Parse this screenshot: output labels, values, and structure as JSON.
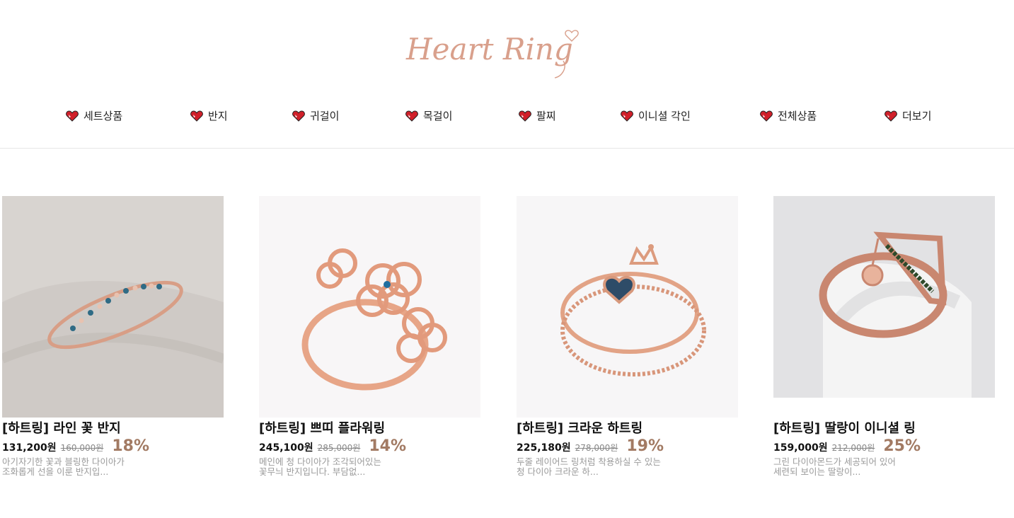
{
  "logo": {
    "text": "Heart Ring",
    "color": "#d9a08c"
  },
  "nav": {
    "icon": "heart-icon",
    "items": [
      {
        "label": "세트상품"
      },
      {
        "label": "반지"
      },
      {
        "label": "귀걸이"
      },
      {
        "label": "목걸이"
      },
      {
        "label": "팔찌"
      },
      {
        "label": "이니셜 각인"
      },
      {
        "label": "전체상품"
      },
      {
        "label": "더보기"
      }
    ]
  },
  "products": [
    {
      "name": "[하트링] 라인 꽃 반지",
      "price": "131,200원",
      "old_price": "160,000원",
      "discount": "18%",
      "desc": "아기자기한 꽃과 블링한 다이아가 조화롭게 선을 이룬 반지입...",
      "image": "rose-gold-flower-line-ring-on-fabric"
    },
    {
      "name": "[하트링] 쁘띠 플라워링",
      "price": "245,100원",
      "old_price": "285,000원",
      "discount": "14%",
      "desc": "메인에 청 다이아가 조각되어있는 꽃무늬 반지입니다. 부담없...",
      "image": "rose-gold-flower-ring"
    },
    {
      "name": "[하트링] 크라운 하트링",
      "price": "225,180원",
      "old_price": "278,000원",
      "discount": "19%",
      "desc": "두줄 레이어드 링처럼 착용하실 수 있는 청 다이아 크라운 하...",
      "image": "rose-gold-crown-heart-ring"
    },
    {
      "name": "[하트링] 딸랑이 이니셜 링",
      "price": "159,000원",
      "old_price": "212,000원",
      "discount": "25%",
      "desc": "그린 다이아몬드가 세공되어 있어 세련되 보이는 딸랑이...",
      "image": "rose-gold-initial-charm-ring-on-stand"
    }
  ],
  "colors": {
    "accent": "#a27a63",
    "heart": "#d0202a"
  }
}
